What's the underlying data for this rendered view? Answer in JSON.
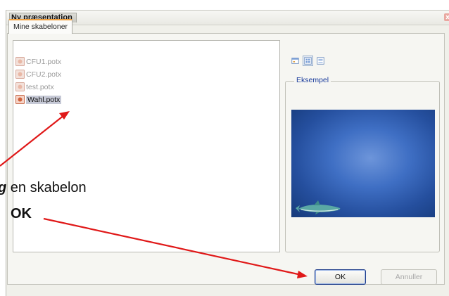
{
  "dialog": {
    "title": "Ny præsentation",
    "tabs": [
      {
        "label": "Mine skabeloner",
        "selected": true
      }
    ]
  },
  "file_list": {
    "items": [
      {
        "name": "CFU1.potx",
        "selected": false
      },
      {
        "name": "CFU2.potx",
        "selected": false
      },
      {
        "name": "test.potx",
        "selected": false
      },
      {
        "name": "Wahl.potx",
        "selected": true
      }
    ]
  },
  "view_buttons": [
    {
      "icon": "large-icons-view-icon",
      "active": false
    },
    {
      "icon": "list-view-icon",
      "active": true
    },
    {
      "icon": "details-view-icon",
      "active": false
    }
  ],
  "preview": {
    "label": "Eksempel"
  },
  "buttons": {
    "ok": "OK",
    "cancel": "Annuller"
  },
  "annotations": {
    "step1_keyword": "g",
    "step1_text": " en skabelon",
    "step2_text": "OK"
  },
  "colors": {
    "arrow": "#e01818",
    "preview_center": "#6d95da",
    "preview_edge": "#163a7a",
    "selection": "#c6c9d6",
    "tab_highlight": "#f0a040",
    "legend_text": "#1a3c9c"
  }
}
